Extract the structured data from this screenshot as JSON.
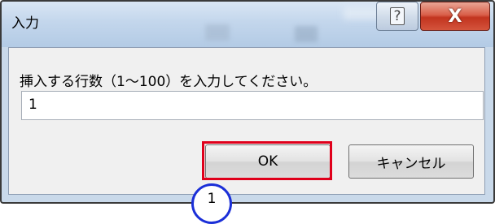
{
  "dialog": {
    "title": "入力",
    "help_label": "?",
    "close_label": "X",
    "prompt": "挿入する行数（1～100）を入力してください。",
    "input_value": "1",
    "ok_label": "OK",
    "cancel_label": "キャンセル"
  },
  "annotation": {
    "marker_number": "1",
    "highlight_color": "#e0001b",
    "marker_color": "#1b2fd8"
  }
}
